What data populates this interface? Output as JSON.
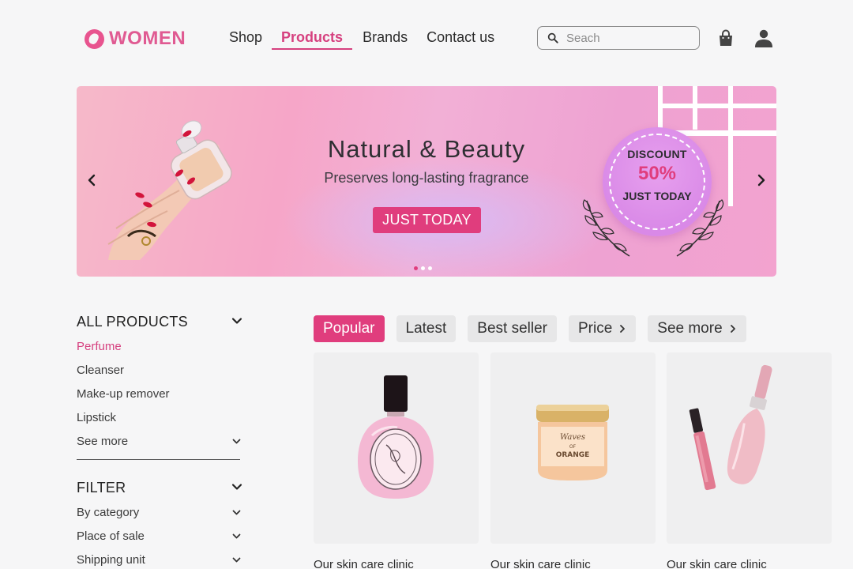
{
  "brand": {
    "name": "WOMEN",
    "accent": "#e03d7d"
  },
  "nav": {
    "items": [
      {
        "label": "Shop",
        "active": false
      },
      {
        "label": "Products",
        "active": true
      },
      {
        "label": "Brands",
        "active": false
      },
      {
        "label": "Contact us",
        "active": false
      }
    ]
  },
  "search": {
    "placeholder": "Seach"
  },
  "icons": {
    "search": "search-icon",
    "bag": "shopping-bag-icon",
    "user": "user-icon"
  },
  "banner": {
    "title": "Natural & Beauty",
    "subtitle": "Preserves long-lasting fragrance",
    "cta": "JUST TODAY",
    "discount": {
      "top": "DISCOUNT",
      "value": "50%",
      "bottom": "JUST TODAY"
    },
    "slides": 3,
    "active_slide": 1
  },
  "sidebar": {
    "products_heading": "ALL PRODUCTS",
    "products": [
      {
        "label": "Perfume",
        "active": true
      },
      {
        "label": "Cleanser",
        "active": false
      },
      {
        "label": "Make-up remover",
        "active": false
      },
      {
        "label": "Lipstick",
        "active": false
      },
      {
        "label": "See more",
        "active": false
      }
    ],
    "filter_heading": "FILTER",
    "filters": [
      {
        "label": "By category"
      },
      {
        "label": "Place of sale"
      },
      {
        "label": "Shipping unit"
      }
    ]
  },
  "tabs": [
    {
      "label": "Popular",
      "active": true
    },
    {
      "label": "Latest",
      "active": false
    },
    {
      "label": "Best seller",
      "active": false
    },
    {
      "label": "Price",
      "active": false
    },
    {
      "label": "See more",
      "active": false
    }
  ],
  "products": [
    {
      "name": "Our skin care clinic",
      "image": "pink-perfume-bottle"
    },
    {
      "name": "Our skin care clinic",
      "image": "orange-cream-jar",
      "jar_text": [
        "Waves",
        "OF",
        "ORANGE"
      ]
    },
    {
      "name": "Our skin care clinic",
      "image": "lip-gloss-and-perfume"
    }
  ]
}
